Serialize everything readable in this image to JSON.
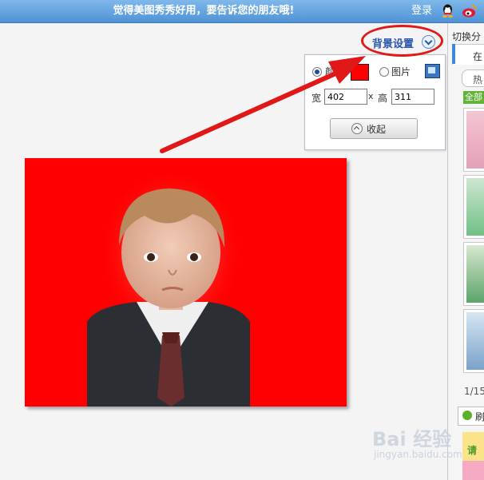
{
  "header": {
    "promo_text": "觉得美图秀秀好用，要告诉您的朋友哦!",
    "login_label": "登录"
  },
  "background_settings": {
    "toggle_label": "背景设置",
    "color_option_label": "颜",
    "image_option_label": "图片",
    "selected_option": "color",
    "color_value": "#ff0000",
    "width_label": "宽",
    "width_value": "402",
    "times_label": "x",
    "height_label": "高",
    "height_value": "311",
    "collapse_label": "收起"
  },
  "sidebar": {
    "switch_label": "切换分",
    "tab_label": "在",
    "hot_label": "热",
    "all_label": "全部",
    "page_count": "1/15",
    "refresh_label": "刷",
    "promo_text": "请"
  },
  "watermark": {
    "logo_text": "Bai 经验",
    "site_text": "jingyan.baidu.com"
  },
  "colors": {
    "photo_background": "#ff0000",
    "annotation": "#e01818",
    "header_bar": "#4f92d6"
  }
}
